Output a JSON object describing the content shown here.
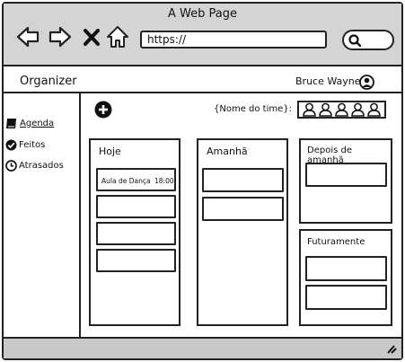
{
  "window": {
    "title": "A Web Page"
  },
  "browser": {
    "url": "https://"
  },
  "app": {
    "title": "Organizer"
  },
  "user": {
    "name": "Bruce Wayne"
  },
  "sidebar": {
    "items": [
      {
        "label": "Agenda",
        "icon": "book-icon"
      },
      {
        "label": "Feitos",
        "icon": "check-circle-icon"
      },
      {
        "label": "Atrasados",
        "icon": "clock-icon"
      }
    ]
  },
  "team": {
    "label": "{Nome do time}:",
    "member_count": 5
  },
  "columns": [
    {
      "title": "Hoje",
      "cards": [
        {
          "text": "Aula de Dança",
          "time": "18:00"
        },
        {
          "text": ""
        },
        {
          "text": ""
        },
        {
          "text": ""
        }
      ]
    },
    {
      "title": "Amanhã",
      "cards": [
        {
          "text": ""
        },
        {
          "text": ""
        }
      ]
    },
    {
      "title": "Depois de amanhã",
      "cards": [
        {
          "text": ""
        }
      ]
    },
    {
      "title": "Futuramente",
      "cards": [
        {
          "text": ""
        },
        {
          "text": ""
        }
      ]
    }
  ]
}
